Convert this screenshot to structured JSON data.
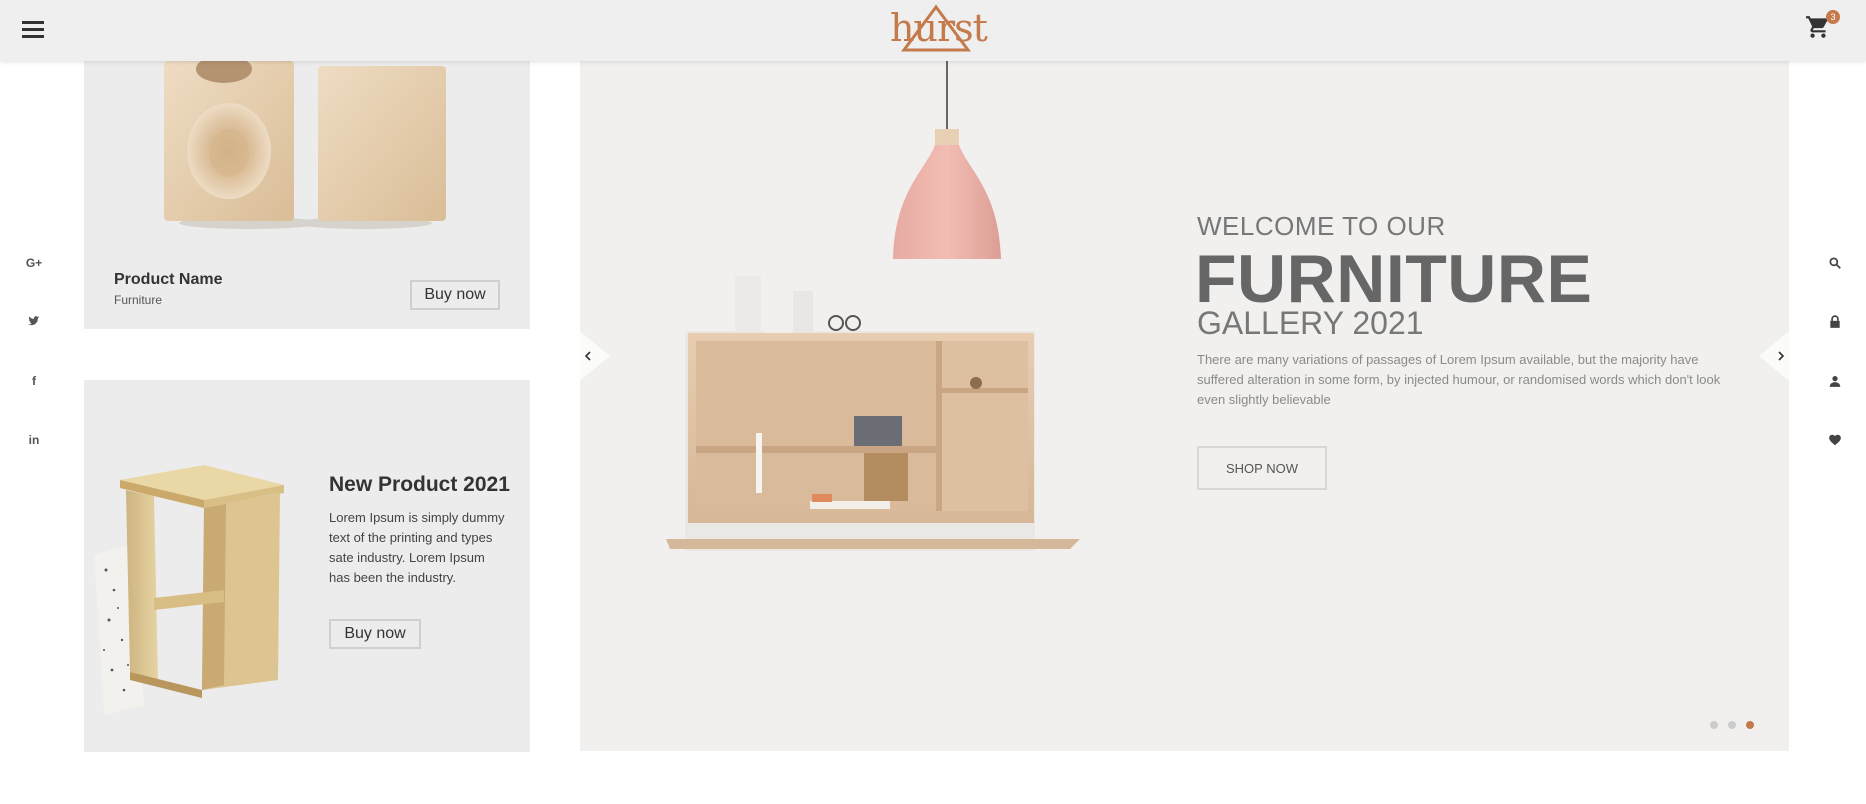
{
  "header": {
    "logo_text": "hurst",
    "cart_count": "3"
  },
  "colors": {
    "accent": "#c47a4a",
    "header_bg": "#efefef",
    "card_bg": "#ececec",
    "hero_bg": "#f1f0ee"
  },
  "social_links": [
    {
      "name": "google-plus",
      "glyph": "G+"
    },
    {
      "name": "twitter",
      "glyph": "t"
    },
    {
      "name": "facebook",
      "glyph": "f"
    },
    {
      "name": "linkedin",
      "glyph": "in"
    }
  ],
  "right_icons": [
    "search-icon",
    "lock-icon",
    "user-icon",
    "heart-icon"
  ],
  "card1": {
    "product_name": "Product Name",
    "category": "Furniture",
    "buy_label": "Buy now"
  },
  "card2": {
    "title": "New Product 2021",
    "description": "Lorem Ipsum is simply dummy text of the printing and types sate industry. Lorem Ipsum has been the industry.",
    "buy_label": "Buy now"
  },
  "hero": {
    "welcome": "WELCOME TO OUR",
    "headline": "FURNITURE",
    "gallery": "GALLERY 2021",
    "description": "There are many variations of passages of Lorem Ipsum available, but the majority have suffered alteration in some form, by injected humour, or randomised words which don't look even slightly believable",
    "cta": "SHOP NOW",
    "active_slide": 3,
    "slide_count": 3
  }
}
